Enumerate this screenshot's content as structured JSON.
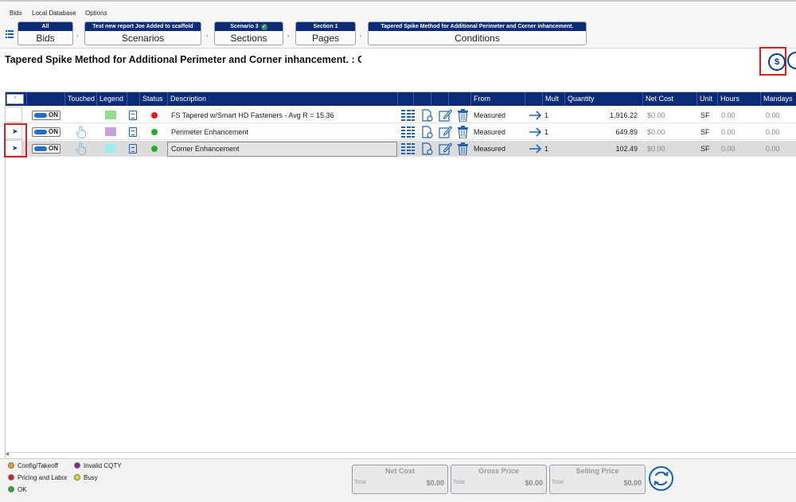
{
  "menu": [
    "Bids",
    "Local Database",
    "Options"
  ],
  "breadcrumbs": [
    {
      "top": "All",
      "bottom": "Bids"
    },
    {
      "top": "Test new report Joe Added to scaffold",
      "bottom": "Scenarios"
    },
    {
      "top": "Scenario 3",
      "bottom": "Sections",
      "badge": "✓"
    },
    {
      "top": "Section 1",
      "bottom": "Pages"
    },
    {
      "top": "Tapered Spike Method for Additional Perimeter and Corner inhancement.",
      "bottom": "Conditions"
    }
  ],
  "page_title": "Tapered Spike Method for Additional Perimeter and Corner inhancement.  : Corner Enhancement",
  "table": {
    "corner_label": "ᴬ",
    "headers": [
      "Touched",
      "Legend",
      "Status",
      "Description",
      "From",
      "Mult",
      "Quantity",
      "Net Cost",
      "Unit",
      "Hours",
      "Mandays"
    ],
    "rows": [
      {
        "toggle": "ON",
        "legend_color": "#8fe08f",
        "status_color": "#e21b1b",
        "description": "FS Tapered w/Smart HD Fasteners - Avg R = 15.36",
        "from": "Measured",
        "mult": "1",
        "quantity": "1,916.22",
        "net_cost": "$0.00",
        "unit": "SF",
        "hours": "0.00",
        "mandays": "0.00",
        "touched": false
      },
      {
        "toggle": "ON",
        "legend_color": "#c8a0d8",
        "status_color": "#1fae2d",
        "description": "Perimeter Enhancement",
        "from": "Measured",
        "mult": "1",
        "quantity": "649.89",
        "net_cost": "$0.00",
        "unit": "SF",
        "hours": "0.00",
        "mandays": "0.00",
        "touched": true
      },
      {
        "toggle": "ON",
        "legend_color": "#a0ecf0",
        "status_color": "#1fae2d",
        "description": "Corner Enhancement",
        "from": "Measured",
        "mult": "1",
        "quantity": "102.49",
        "net_cost": "$0.00",
        "unit": "SF",
        "hours": "0.00",
        "mandays": "0.00",
        "touched": true
      }
    ]
  },
  "status_key": [
    {
      "label": "Config/Takeoff",
      "color": "#f0a020"
    },
    {
      "label": "Invalid CQTY",
      "color": "#8a1fa0"
    },
    {
      "label": "Pricing and Labor",
      "color": "#e21b1b"
    },
    {
      "label": "Busy",
      "color": "#f2d21b"
    },
    {
      "label": "OK",
      "color": "#1fae2d"
    }
  ],
  "totals": [
    {
      "title": "Net Cost",
      "label": "Total",
      "value": "$0.00"
    },
    {
      "title": "Gross Price",
      "label": "Total",
      "value": "$0.00"
    },
    {
      "title": "Selling Price",
      "label": "Total",
      "value": "$0.00"
    }
  ],
  "icons": {
    "menu": "list-icon",
    "cost_button": "dollar-circle-icon",
    "refresh": "refresh-icon",
    "touched": "hand-pointer-icon",
    "row_actions": [
      "grid-icon",
      "document-add-icon",
      "edit-icon",
      "trash-icon",
      "arrow-right-icon"
    ]
  },
  "colors": {
    "header_bg": "#0a2c78",
    "accent": "#1560bd",
    "highlight_border": "#d61f1f"
  }
}
